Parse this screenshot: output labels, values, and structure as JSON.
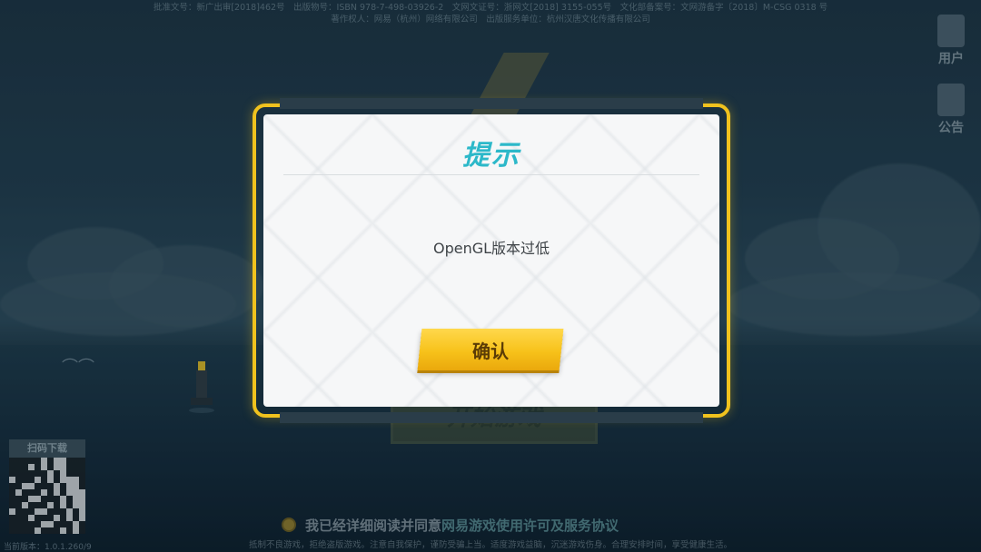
{
  "top_info": {
    "line1": "批准文号：新广出审[2018]462号　出版物号：ISBN 978-7-498-03926-2　文网文证号：浙网文[2018] 3155-055号　文化部备案号：文网游备字〔2018〕M-CSG 0318 号",
    "line2": "著作权人：网易（杭州）网络有限公司　出版服务单位：杭州汉唐文化传播有限公司"
  },
  "side_buttons": {
    "user": "用户",
    "notice": "公告"
  },
  "start_button": "开始游戏",
  "qr": {
    "label": "扫码下载"
  },
  "version": "当前版本：1.0.1.260/9",
  "agreement": {
    "prefix": "我已经详细阅读并同意",
    "link": "网易游戏使用许可及服务协议"
  },
  "health_notice": "抵制不良游戏，拒绝盗版游戏。注意自我保护，谨防受骗上当。适度游戏益脑，沉迷游戏伤身。合理安排时间，享受健康生活。",
  "dialog": {
    "title": "提示",
    "message": "OpenGL版本过低",
    "confirm_label": "确认"
  },
  "colors": {
    "accent": "#f0c21e",
    "title": "#2cb8c9",
    "button": "#f7c21a"
  }
}
